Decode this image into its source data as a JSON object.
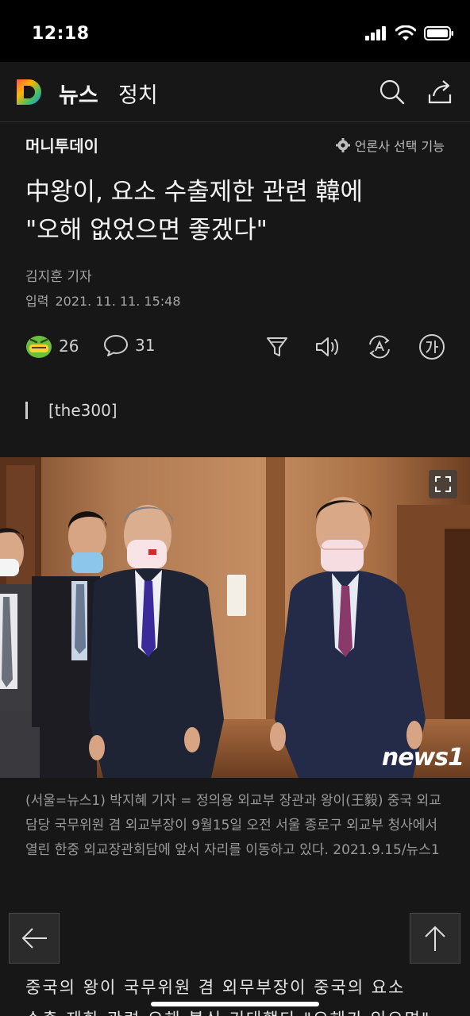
{
  "status": {
    "time": "12:18"
  },
  "header": {
    "news_label": "뉴스",
    "section_label": "정치"
  },
  "press": {
    "name": "머니투데이",
    "select_label": "언론사 선택 기능"
  },
  "article": {
    "headline_line1": "中왕이, 요소 수출제한 관련 韓에",
    "headline_line2": "\"오해 없었으면 좋겠다\"",
    "byline": "김지훈 기자",
    "pub_label": "입력",
    "pub_date": "2021. 11. 11. 15:48",
    "subtitle": "[the300]",
    "caption": "(서울=뉴스1) 박지혜 기자 = 정의용 외교부 장관과 왕이(王毅) 중국 외교담당 국무위원 겸 외교부장이 9월15일 오전 서울 종로구 외교부 청사에서 열린 한중 외교장관회담에 앞서 자리를 이동하고 있다. 2021.9.15/뉴스1",
    "body_line1": "중국의 왕이 국무위원 겸 외무부장이 중국의 요소",
    "body_line2": "수출 제한 관련 오해 불식 기대했다 \"오해가 있으면\""
  },
  "reactions": {
    "emoji_count": "26",
    "comment_count": "31"
  },
  "photo": {
    "watermark": "news1"
  },
  "colors": {
    "background": "#171717",
    "statusbar": "#000000",
    "text": "#e8e8e8",
    "muted": "#a6a6a6"
  }
}
